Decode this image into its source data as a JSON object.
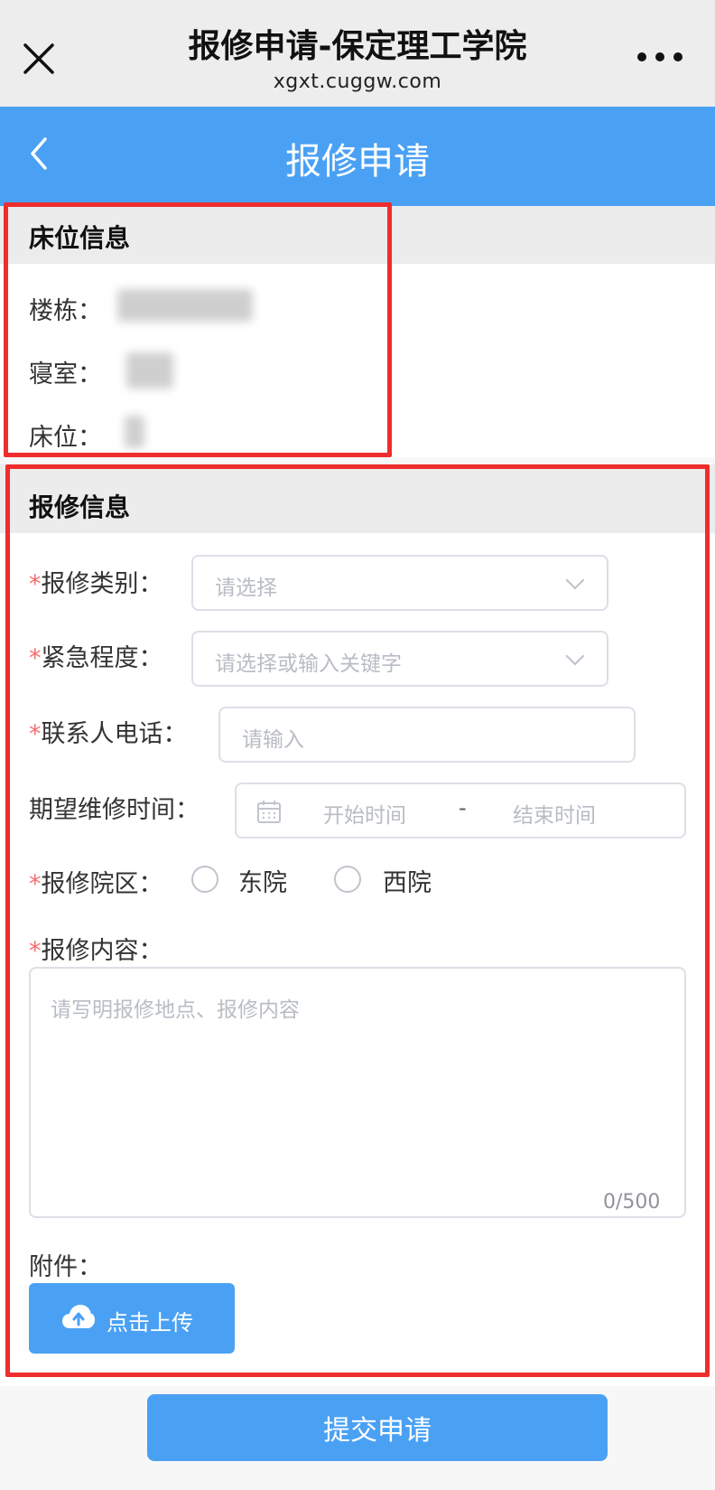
{
  "browser": {
    "title": "报修申请-保定理工学院",
    "url": "xgxt.cuggw.com",
    "close_icon": "close-icon",
    "more_icon": "more-icon"
  },
  "header": {
    "title": "报修申请",
    "back_icon": "chevron-left-icon",
    "color": "#4aa1f4"
  },
  "bed_info": {
    "title": "床位信息",
    "building_label": "楼栋：",
    "room_label": "寝室：",
    "bed_label": "床位："
  },
  "repair_info": {
    "title": "报修信息",
    "required_mark": "*",
    "category": {
      "label": "报修类别：",
      "placeholder": "请选择"
    },
    "urgency": {
      "label": "紧急程度：",
      "placeholder": "请选择或输入关键字"
    },
    "phone": {
      "label": "联系人电话：",
      "placeholder": "请输入"
    },
    "time": {
      "label": "期望维修时间：",
      "start_placeholder": "开始时间",
      "separator": "-",
      "end_placeholder": "结束时间"
    },
    "campus": {
      "label": "报修院区：",
      "options": [
        "东院",
        "西院"
      ]
    },
    "content": {
      "label": "报修内容：",
      "placeholder": "请写明报修地点、报修内容",
      "counter": "0/500"
    },
    "attachment": {
      "label": "附件：",
      "upload_label": "点击上传"
    }
  },
  "submit": {
    "label": "提交申请"
  },
  "colors": {
    "accent": "#4aa1f4",
    "required": "#f56c6c",
    "highlight_frame": "#ef2d2d"
  }
}
